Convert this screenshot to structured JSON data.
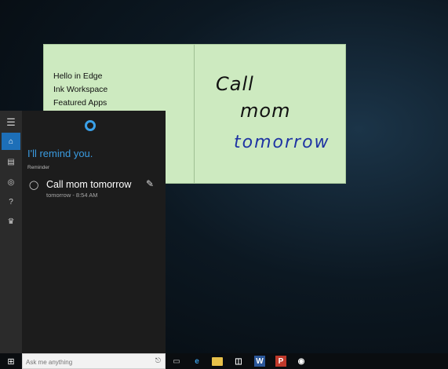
{
  "sticky_note": {
    "list_items": [
      "Hello in Edge",
      "Ink Workspace",
      "Featured Apps"
    ],
    "ink_lines": [
      "Call",
      "mom",
      "tomorrow"
    ],
    "ink_colors": [
      "#111111",
      "#111111",
      "#1e33a3"
    ]
  },
  "cortana": {
    "rail_icons": [
      "hamburger-menu-icon",
      "home-icon",
      "notebook-icon",
      "location-pin-icon",
      "help-icon",
      "feedback-icon"
    ],
    "response": "I'll remind you.",
    "section_label": "Reminder",
    "reminder": {
      "title": "Call mom tomorrow",
      "time": "tomorrow - 8:54 AM"
    }
  },
  "taskbar": {
    "search_placeholder": "Ask me anything",
    "pinned": [
      "task-view-icon",
      "edge-icon",
      "file-explorer-icon",
      "store-icon",
      "word-icon",
      "pdf-icon",
      "maps-icon"
    ]
  },
  "colors": {
    "accent": "#1d6fb8",
    "cortana_text": "#3a9be0",
    "sticky_bg": "#cdeac0"
  }
}
